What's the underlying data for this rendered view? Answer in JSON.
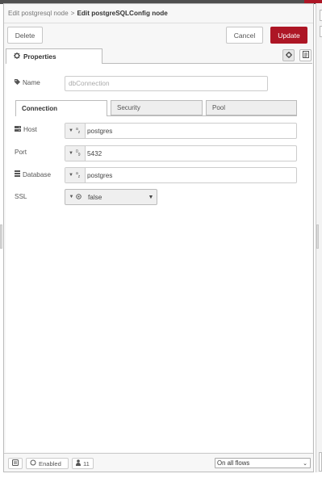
{
  "breadcrumb": {
    "parent": "Edit postgresql node",
    "separator": ">",
    "current": "Edit postgreSQLConfig node"
  },
  "toolbar": {
    "delete_label": "Delete",
    "cancel_label": "Cancel",
    "update_label": "Update"
  },
  "properties_tab": {
    "label": "Properties"
  },
  "name_field": {
    "label": "Name",
    "placeholder": "dbConnection",
    "value": ""
  },
  "subtabs": [
    {
      "label": "Connection",
      "active": true
    },
    {
      "label": "Security",
      "active": false
    },
    {
      "label": "Pool",
      "active": false
    }
  ],
  "host": {
    "label": "Host",
    "type_icon": "string-type-icon",
    "value": "postgres"
  },
  "port": {
    "label": "Port",
    "type_icon": "number-type-icon",
    "value": "5432"
  },
  "database": {
    "label": "Database",
    "type_icon": "string-type-icon",
    "value": "postgres"
  },
  "ssl": {
    "label": "SSL",
    "type_icon": "boolean-type-icon",
    "value": "false"
  },
  "footer": {
    "enabled_label": "Enabled",
    "users_count": "11",
    "flows_scope": "On all flows"
  },
  "colors": {
    "accent": "#ad1625",
    "topbar": "#505050"
  }
}
